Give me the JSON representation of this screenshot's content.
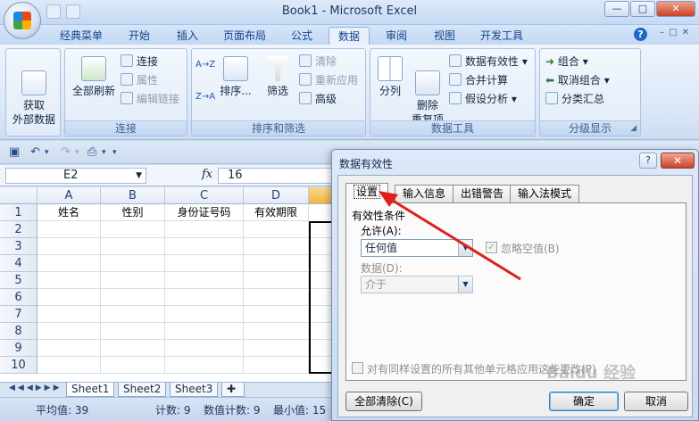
{
  "window": {
    "title": "Book1 - Microsoft Excel",
    "min": "—",
    "max": "□",
    "close": "✕"
  },
  "tabs": [
    "经典菜单",
    "开始",
    "插入",
    "页面布局",
    "公式",
    "数据",
    "审阅",
    "视图",
    "开发工具"
  ],
  "active_tab": "数据",
  "ribbon": {
    "get_external": "获取\n外部数据",
    "refresh_all": "全部刷新",
    "connections": "连接",
    "properties": "属性",
    "edit_links": "编辑链接",
    "sort_az": "A→Z",
    "sort_za": "Z→A",
    "sort": "排序...",
    "filter": "筛选",
    "clear": "清除",
    "reapply": "重新应用",
    "advanced": "高级",
    "text_to_columns": "分列",
    "remove_duplicates": "删除\n重复项",
    "data_validation": "数据有效性",
    "consolidate": "合并计算",
    "what_if": "假设分析",
    "group": "组合",
    "ungroup": "取消组合",
    "subtotal": "分类汇总",
    "groups": {
      "connections": "连接",
      "sort_filter": "排序和筛选",
      "data_tools": "数据工具",
      "outline": "分级显示"
    }
  },
  "formula_bar": {
    "name_box": "E2",
    "fx": "fx",
    "content": "16"
  },
  "grid": {
    "columns": [
      "A",
      "B",
      "C",
      "D"
    ],
    "row1": [
      "姓名",
      "性别",
      "身份证号码",
      "有效期限"
    ],
    "rows": [
      "1",
      "2",
      "3",
      "4",
      "5",
      "6",
      "7",
      "8",
      "9",
      "10"
    ]
  },
  "sheets": [
    "Sheet1",
    "Sheet2",
    "Sheet3"
  ],
  "status": {
    "average": "平均值: 39",
    "count": "计数: 9",
    "numeric_count": "数值计数: 9",
    "min": "最小值: 15"
  },
  "dialog": {
    "title": "数据有效性",
    "help": "?",
    "close": "✕",
    "tabs": [
      "设置",
      "输入信息",
      "出错警告",
      "输入法模式"
    ],
    "criteria_label": "有效性条件",
    "allow_label": "允许(A):",
    "allow_value": "任何值",
    "ignore_blank": "忽略空值(B)",
    "data_label": "数据(D):",
    "data_value": "介于",
    "apply_all": "对有同样设置的所有其他单元格应用这些更改(P)",
    "clear_all": "全部清除(C)",
    "ok": "确定",
    "cancel": "取消"
  },
  "watermark": "Baidu 经验",
  "colors": {
    "arrow": "#e0201a",
    "ribbon_bg": "#dbe7f7",
    "selected_col": "#f3b443"
  }
}
